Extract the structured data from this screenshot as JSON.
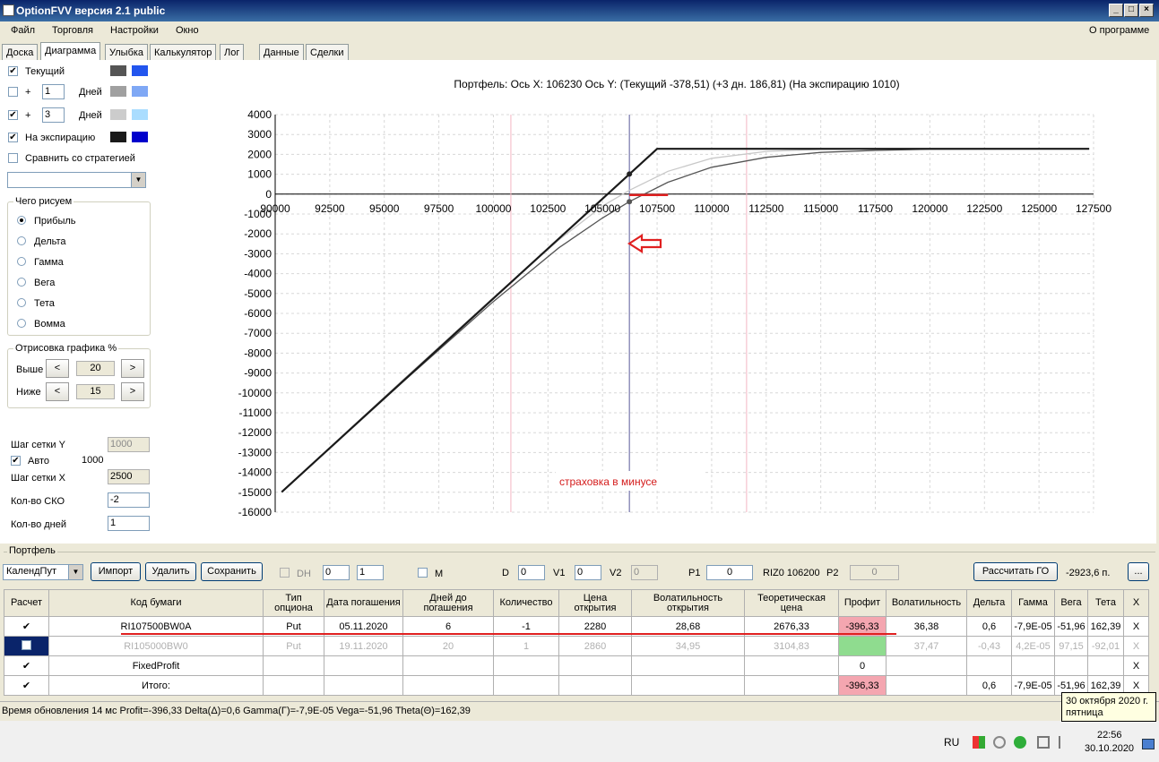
{
  "window": {
    "title": "OptionFVV версия 2.1 public"
  },
  "menu": {
    "items": [
      "Файл",
      "Торговля",
      "Настройки",
      "Окно"
    ],
    "about": "О программе"
  },
  "tabs": [
    "Доска",
    "Диаграмма",
    "Улыбка",
    "Калькулятор",
    "Лог",
    "Данные",
    "Сделки"
  ],
  "left": {
    "current_label": "Текущий",
    "plus": "+",
    "days_label": "Дней",
    "days1": "1",
    "days2": "3",
    "expiry_label": "На экспирацию",
    "compare_label": "Сравнить со стратегией",
    "draw_group": "Чего рисуем",
    "draw_options": [
      "Прибыль",
      "Дельта",
      "Гамма",
      "Вега",
      "Тета",
      "Вомма"
    ],
    "render_group": "Отрисовка графика %",
    "above_label": "Выше",
    "below_label": "Ниже",
    "above_value": "20",
    "below_value": "15",
    "btn_left": "<",
    "btn_right": ">",
    "grid_y_label": "Шаг сетки Y",
    "grid_y_value": "1000",
    "auto_label": "Авто",
    "auto_value": "1000",
    "grid_x_label": "Шаг сетки X",
    "grid_x_value": "2500",
    "sko_label": "Кол-во СКО",
    "sko_value": "-2",
    "days_count_label": "Кол-во дней",
    "days_count_value": "1"
  },
  "colors": {
    "current_dark": "#555555",
    "current_blue": "#2255ee",
    "d1_dark": "#a0a0a0",
    "d1_blue": "#7fa8f5",
    "d3_dark": "#cccccc",
    "d3_blue": "#aaddff",
    "exp_dark": "#1a1a1a",
    "exp_blue": "#0000cc"
  },
  "chart_data": {
    "type": "line",
    "title": "Портфель: Ось X: 106230 Ось Y:  (Текущий -378,51)  (+3 дн. 186,81)  (На экспирацию 1010)",
    "xlim": [
      90000,
      127500
    ],
    "ylim": [
      -16000,
      4000
    ],
    "x_ticks": [
      90000,
      92500,
      95000,
      97500,
      100000,
      102500,
      105000,
      107500,
      110000,
      112500,
      115000,
      117500,
      120000,
      122500,
      125000,
      127500
    ],
    "y_ticks": [
      4000,
      3000,
      2000,
      1000,
      0,
      -1000,
      -2000,
      -3000,
      -4000,
      -5000,
      -6000,
      -7000,
      -8000,
      -9000,
      -10000,
      -11000,
      -12000,
      -13000,
      -14000,
      -15000,
      -16000
    ],
    "cursor_x": 106230,
    "range_lines_x": [
      100800,
      111600
    ],
    "annotation": "страховка в минусе",
    "series": [
      {
        "color": "#1a1a1a",
        "x": [
          90300,
          107500,
          127300
        ],
        "y": [
          -14980,
          2280,
          2280
        ]
      },
      {
        "color": "#555555",
        "x": [
          90300,
          96000,
          100000,
          103000,
          105000,
          106230,
          108000,
          110000,
          112500,
          115000,
          117500,
          120000,
          127300
        ],
        "y": [
          -14980,
          -9300,
          -5400,
          -2700,
          -1200,
          -379,
          600,
          1350,
          1850,
          2100,
          2200,
          2260,
          2280
        ]
      },
      {
        "color": "#c8c8c8",
        "x": [
          90300,
          96000,
          100000,
          103000,
          105000,
          106230,
          108000,
          110000,
          112500,
          115000,
          120000,
          127300
        ],
        "y": [
          -14980,
          -9200,
          -5200,
          -2300,
          -600,
          187,
          1150,
          1800,
          2150,
          2250,
          2280,
          2280
        ]
      }
    ]
  },
  "portfolio": {
    "label": "Портфель",
    "strategy": "КалендПут",
    "import": "Импорт",
    "delete": "Удалить",
    "save": "Сохранить",
    "dh": "DH",
    "dh_val1": "0",
    "dh_val2": "1",
    "m": "M",
    "d_label": "D",
    "d_val": "0",
    "v1_label": "V1",
    "v1_val": "0",
    "v2_label": "V2",
    "v2_val": "0",
    "p1_label": "P1",
    "p1_val": "0",
    "riz": "RIZ0 106200",
    "p2_label": "P2",
    "p2_val": "0",
    "calc_go": "Рассчитать ГО",
    "go_value": "-2923,6 п.",
    "more": "..."
  },
  "table": {
    "headers": [
      "Расчет",
      "Код бумаги",
      "Тип опциона",
      "Дата погашения",
      "Дней до погашения",
      "Количество",
      "Цена открытия",
      "Волатильность открытия",
      "Теоретическая цена",
      "Профит",
      "Волатильность",
      "Дельта",
      "Гамма",
      "Вега",
      "Тета",
      "X"
    ],
    "rows": [
      [
        "✔",
        "RI107500BW0A",
        "Put",
        "05.11.2020",
        "6",
        "-1",
        "2280",
        "28,68",
        "2676,33",
        "-396,33",
        "36,38",
        "0,6",
        "-7,9E-05",
        "-51,96",
        "162,39",
        "X"
      ],
      [
        "",
        "RI105000BW0",
        "Put",
        "19.11.2020",
        "20",
        "1",
        "2860",
        "34,95",
        "3104,83",
        "",
        "37,47",
        "-0,43",
        "4,2E-05",
        "97,15",
        "-92,01",
        "X"
      ],
      [
        "✔",
        "",
        "",
        "",
        "",
        "",
        "",
        "",
        "",
        "0",
        "",
        "",
        "",
        "",
        "",
        "X"
      ],
      [
        "✔",
        "",
        "",
        "",
        "",
        "",
        "",
        "",
        "",
        "-396,33",
        "",
        "0,6",
        "-7,9E-05",
        "-51,96",
        "162,39",
        "X"
      ]
    ],
    "fixed_profit": "FixedProfit",
    "total": "Итого:"
  },
  "status": {
    "text": "Время обновления 14 мс  Profit=-396,33 Delta(Δ)=0,6 Gamma(Γ)=-7,9E-05 Vega=-51,96 Theta(Θ)=162,39"
  },
  "tooltip": {
    "line1": "30 октября 2020 г.",
    "line2": "пятница"
  },
  "taskbar": {
    "lang": "RU",
    "time": "22:56",
    "date": "30.10.2020"
  }
}
